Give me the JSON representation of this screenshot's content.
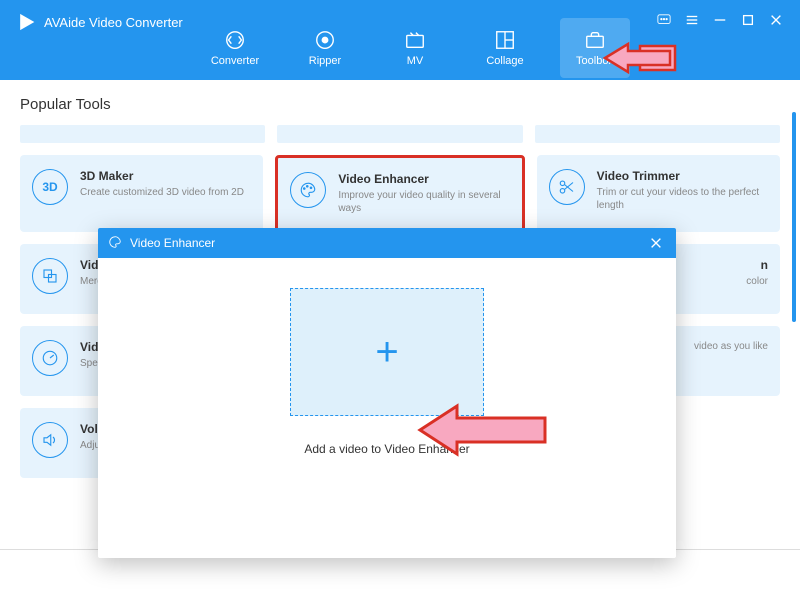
{
  "app": {
    "title": "AVAide Video Converter"
  },
  "tabs": [
    {
      "label": "Converter"
    },
    {
      "label": "Ripper"
    },
    {
      "label": "MV"
    },
    {
      "label": "Collage"
    },
    {
      "label": "Toolbox"
    }
  ],
  "section_title": "Popular Tools",
  "cards": {
    "r1c1": {
      "title": "3D Maker",
      "desc": "Create customized 3D video from 2D",
      "icon_label": "3D"
    },
    "r1c2": {
      "title": "Video Enhancer",
      "desc": "Improve your video quality in several ways"
    },
    "r1c3": {
      "title": "Video Trimmer",
      "desc": "Trim or cut your videos to the perfect length"
    },
    "r2c1": {
      "title": "Vide",
      "desc": "Merg"
    },
    "r2c3": {
      "title": "n",
      "desc": "color"
    },
    "r3c1": {
      "title": "Vide",
      "desc": "Spee \neasi"
    },
    "r3c3": {
      "title": "",
      "desc": "video as you like"
    },
    "r4c1": {
      "title": "Vol",
      "desc": "Adju"
    }
  },
  "dialog": {
    "title": "Video Enhancer",
    "caption": "Add a video to Video Enhancer"
  }
}
